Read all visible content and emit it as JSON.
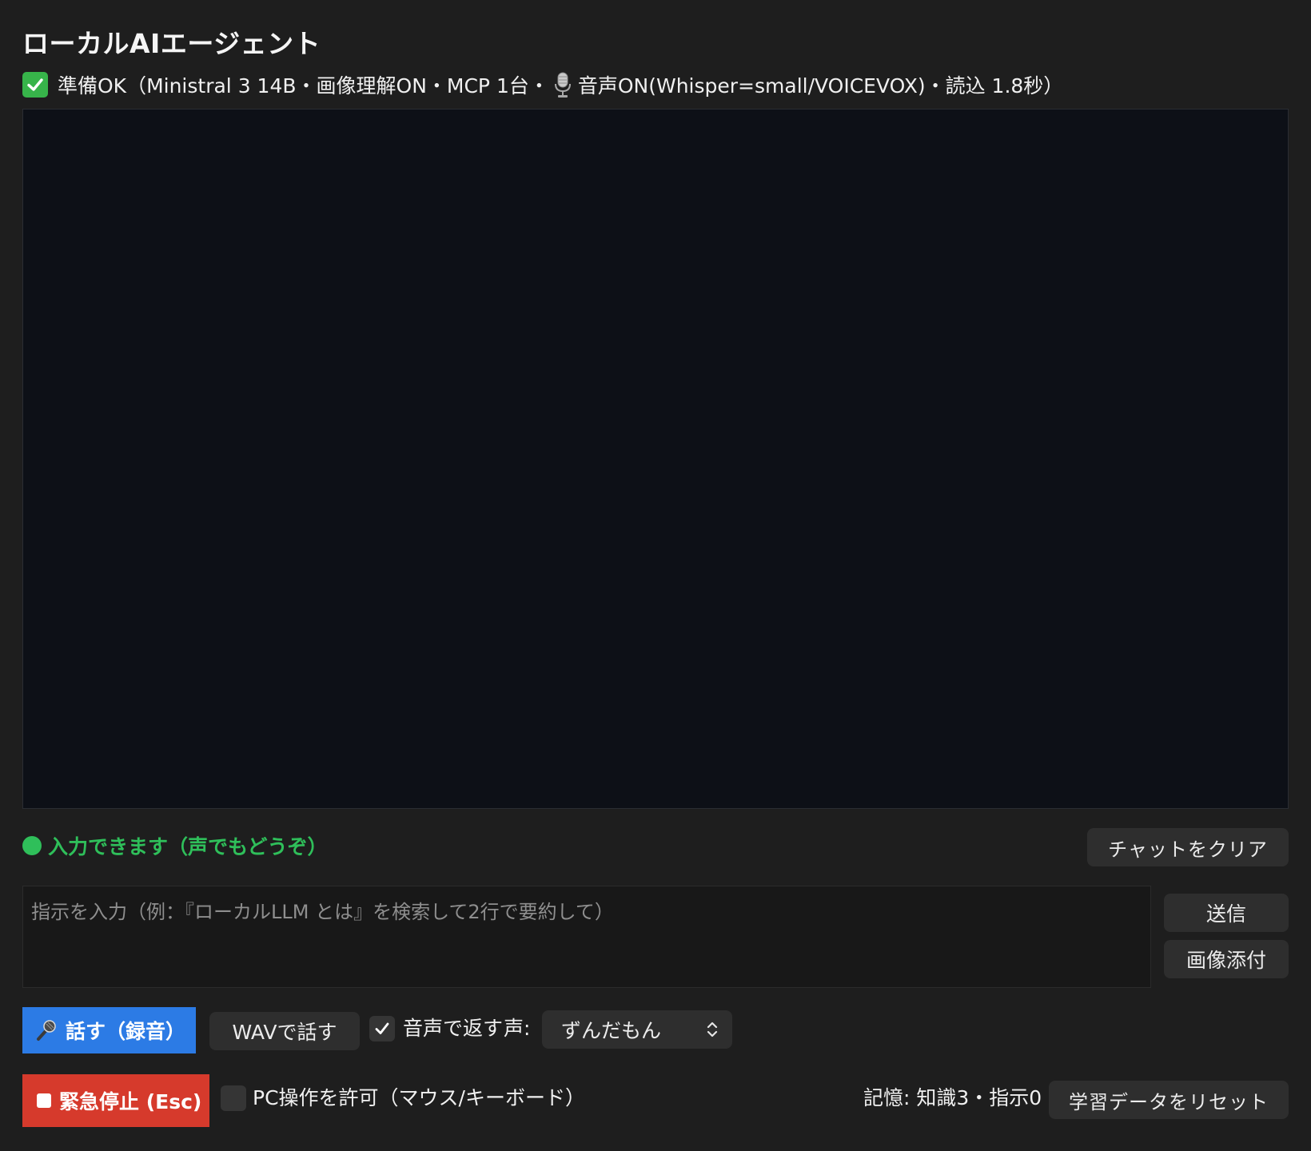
{
  "app": {
    "title": "ローカルAIエージェント",
    "status_text": "準備OK（Ministral 3 14B・画像理解ON・MCP 1台・",
    "status_voice_text": "音声ON(Whisper=small/VOICEVOX)・読込 1.8秒）"
  },
  "input_status": {
    "text": "入力できます（声でもどうぞ）",
    "color": "#2fbf5a"
  },
  "buttons": {
    "clear_chat": "チャットをクリア",
    "send": "送信",
    "attach_image": "画像添付",
    "speak": "話す（録音）",
    "wav_speak": "WAVで話す",
    "emergency_stop": "緊急停止 (Esc)",
    "reset_learning": "学習データをリセット"
  },
  "instruction_input": {
    "placeholder": "指示を入力（例：『ローカルLLM とは』を検索して2行で要約して）",
    "value": ""
  },
  "voice_options": {
    "reply_with_voice_label": "音声で返す",
    "reply_with_voice_checked": true,
    "voice_label": "声:",
    "voice_selected": "ずんだもん"
  },
  "pc_control": {
    "label": "PC操作を許可（マウス/キーボード）",
    "checked": false
  },
  "memory": {
    "status": "記憶: 知識3・指示0"
  },
  "colors": {
    "accent_blue": "#2c7be5",
    "danger_red": "#d63a2c",
    "ok_green": "#37b44a",
    "background": "#1e1e1e",
    "chat_background": "#0d1017"
  },
  "icons": {
    "status_check": "check-mark-icon",
    "status_mic": "studio-microphone-icon",
    "speak_mic": "microphone-icon",
    "emergency_stop": "stop-square-icon",
    "voice_select": "chevron-up-down-icon"
  }
}
